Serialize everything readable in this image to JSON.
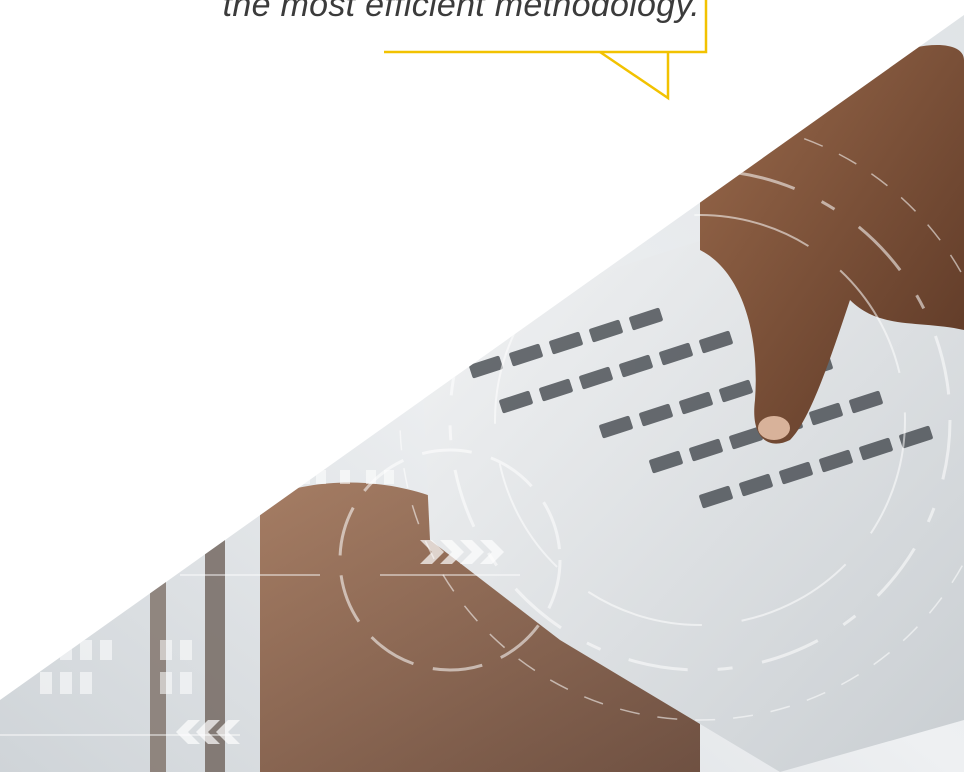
{
  "quote": {
    "text": "the most efficient methodology."
  },
  "colors": {
    "accent": "#f2c200",
    "background": "#ffffff",
    "quote_text": "#3b3b3b"
  },
  "illustration": {
    "subject": "hand typing on laptop keyboard with digital HUD overlay"
  }
}
